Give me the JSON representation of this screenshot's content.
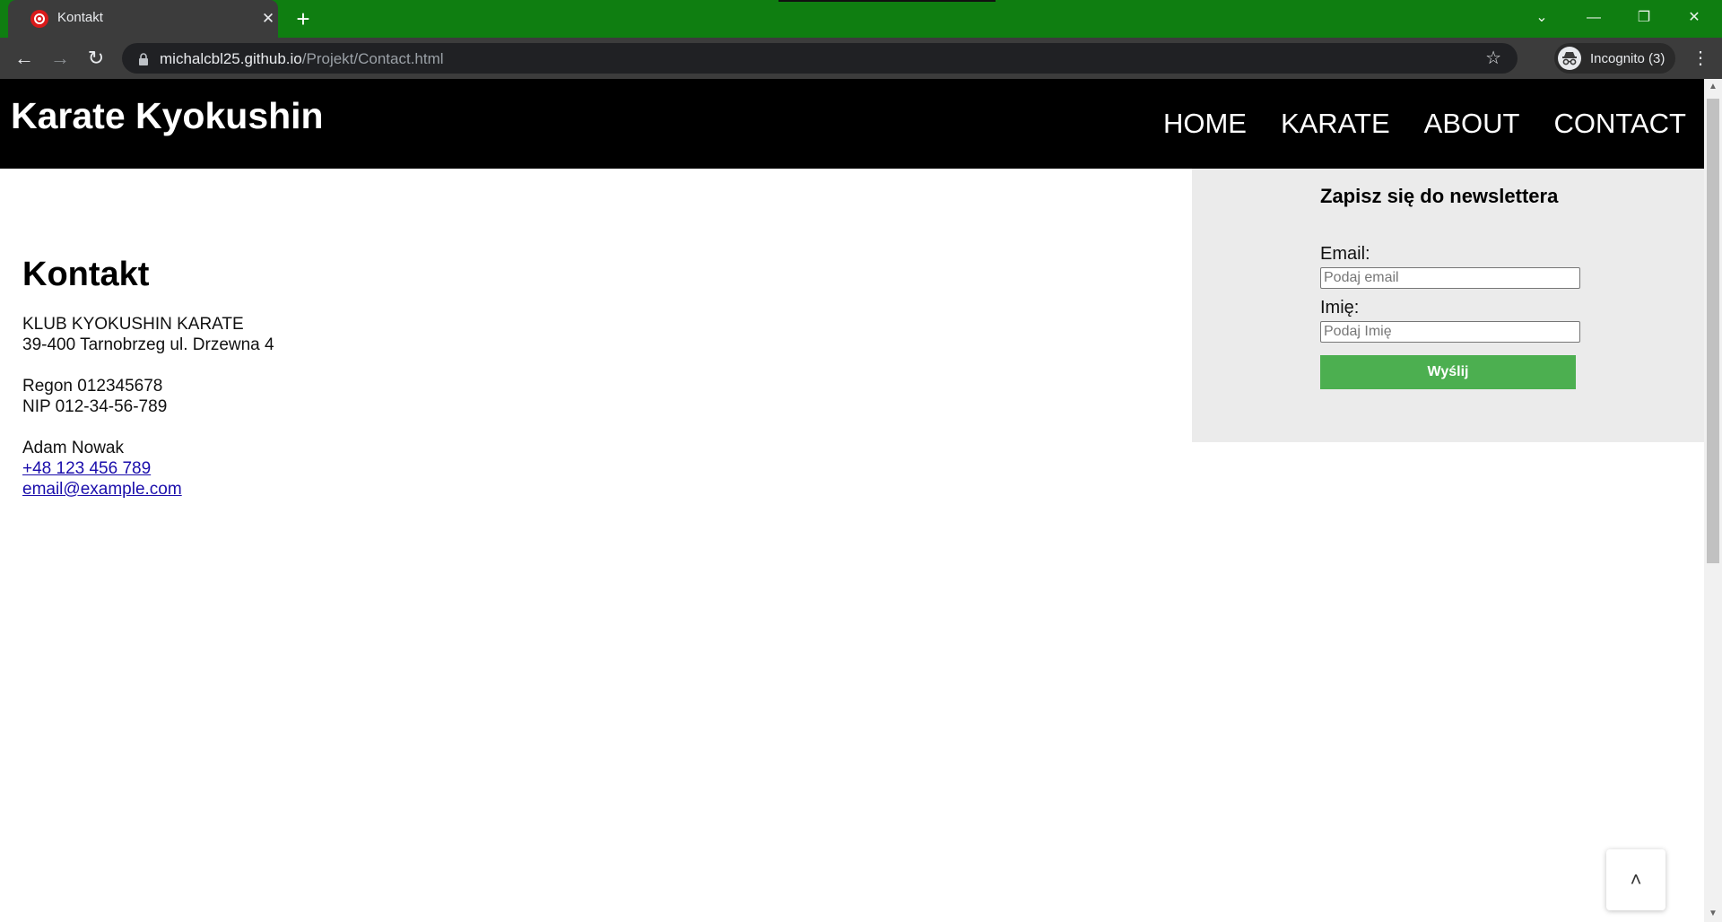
{
  "browser": {
    "tab_title": "Kontakt",
    "tab_close": "✕",
    "new_tab": "+",
    "url_host": "michalcbl25.github.io",
    "url_path": "/Projekt/Contact.html",
    "incognito_label": "Incognito (3)",
    "icons": {
      "back": "←",
      "forward": "→",
      "reload": "↻",
      "star": "☆",
      "menu": "⋮",
      "tab_search": "⌄",
      "minimize": "—",
      "restore": "❐",
      "close": "✕"
    },
    "colors": {
      "frame": "#0f7e11",
      "toolbar": "#3c3c3c",
      "omnibox": "#202124"
    }
  },
  "site": {
    "title": "Karate Kyokushin",
    "nav": [
      "HOME",
      "KARATE",
      "ABOUT",
      "CONTACT"
    ]
  },
  "contact": {
    "heading": "Kontakt",
    "club_name": "KLUB KYOKUSHIN KARATE",
    "address": "39-400 Tarnobrzeg ul. Drzewna 4",
    "regon": "Regon 012345678",
    "nip": "NIP 012-34-56-789",
    "person": "Adam Nowak",
    "phone": "+48 123 456 789",
    "email": "email@example.com"
  },
  "newsletter": {
    "heading": "Zapisz się do newslettera",
    "email_label": "Email:",
    "email_placeholder": "Podaj email",
    "name_label": "Imię:",
    "name_placeholder": "Podaj Imię",
    "submit_label": "Wyślij",
    "button_color": "#4caf50"
  },
  "scroll_to_top": "˄"
}
